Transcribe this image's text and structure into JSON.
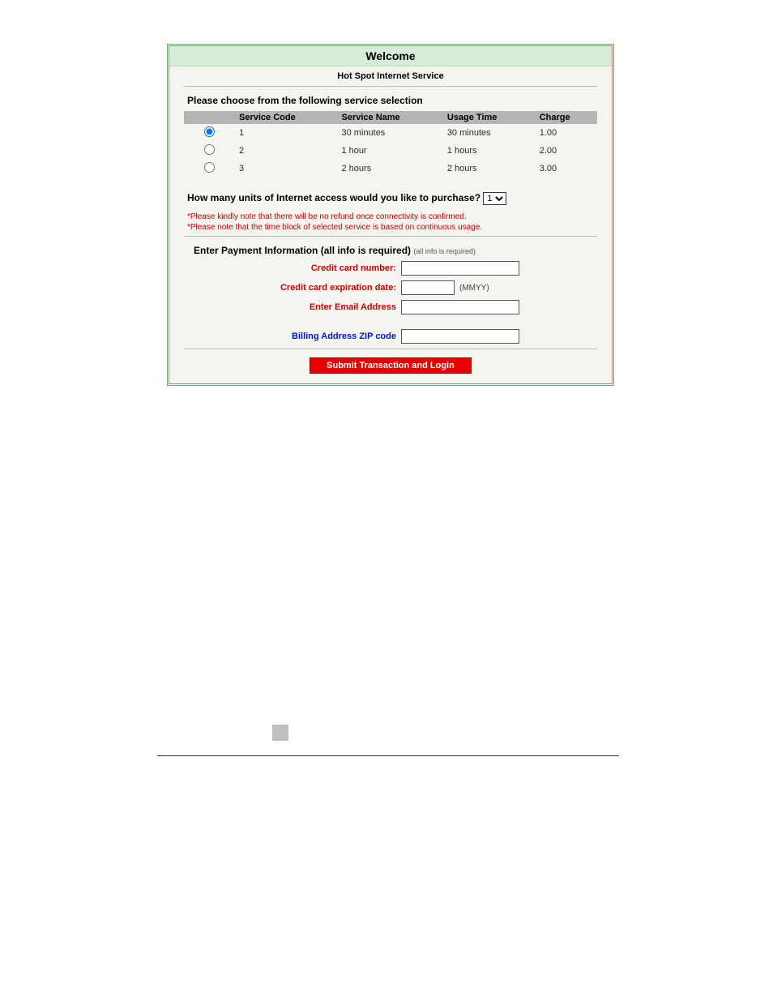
{
  "welcome_title": "Welcome",
  "subtitle": "Hot Spot Internet Service",
  "service_section_title": "Please choose from the following service selection",
  "table_headers": {
    "blank": "",
    "service_code": "Service Code",
    "service_name": "Service Name",
    "usage_time": "Usage Time",
    "charge": "Charge"
  },
  "services": [
    {
      "selected": true,
      "code": "1",
      "name": "30 minutes",
      "usage": "30 minutes",
      "charge": "1.00"
    },
    {
      "selected": false,
      "code": "2",
      "name": "1 hour",
      "usage": "1 hours",
      "charge": "2.00"
    },
    {
      "selected": false,
      "code": "3",
      "name": "2 hours",
      "usage": "2 hours",
      "charge": "3.00"
    }
  ],
  "units_question": "How many units of Internet access would you like to purchase?",
  "units_value": "1",
  "notes": [
    "*Please kindly note that there will be no refund once connectivity is confirmed.",
    "*Please note that the time block of selected service is based on continuous usage."
  ],
  "payment": {
    "title": "Enter Payment Information (all info is required)",
    "hint": "(all info is required)",
    "cc_number_label": "Credit card number:",
    "cc_exp_label": "Credit card expiration date:",
    "cc_exp_hint": "(MMYY)",
    "email_label": "Enter Email Address",
    "zip_label": "Billing Address ZIP code"
  },
  "submit_label": "Submit Transaction and Login"
}
